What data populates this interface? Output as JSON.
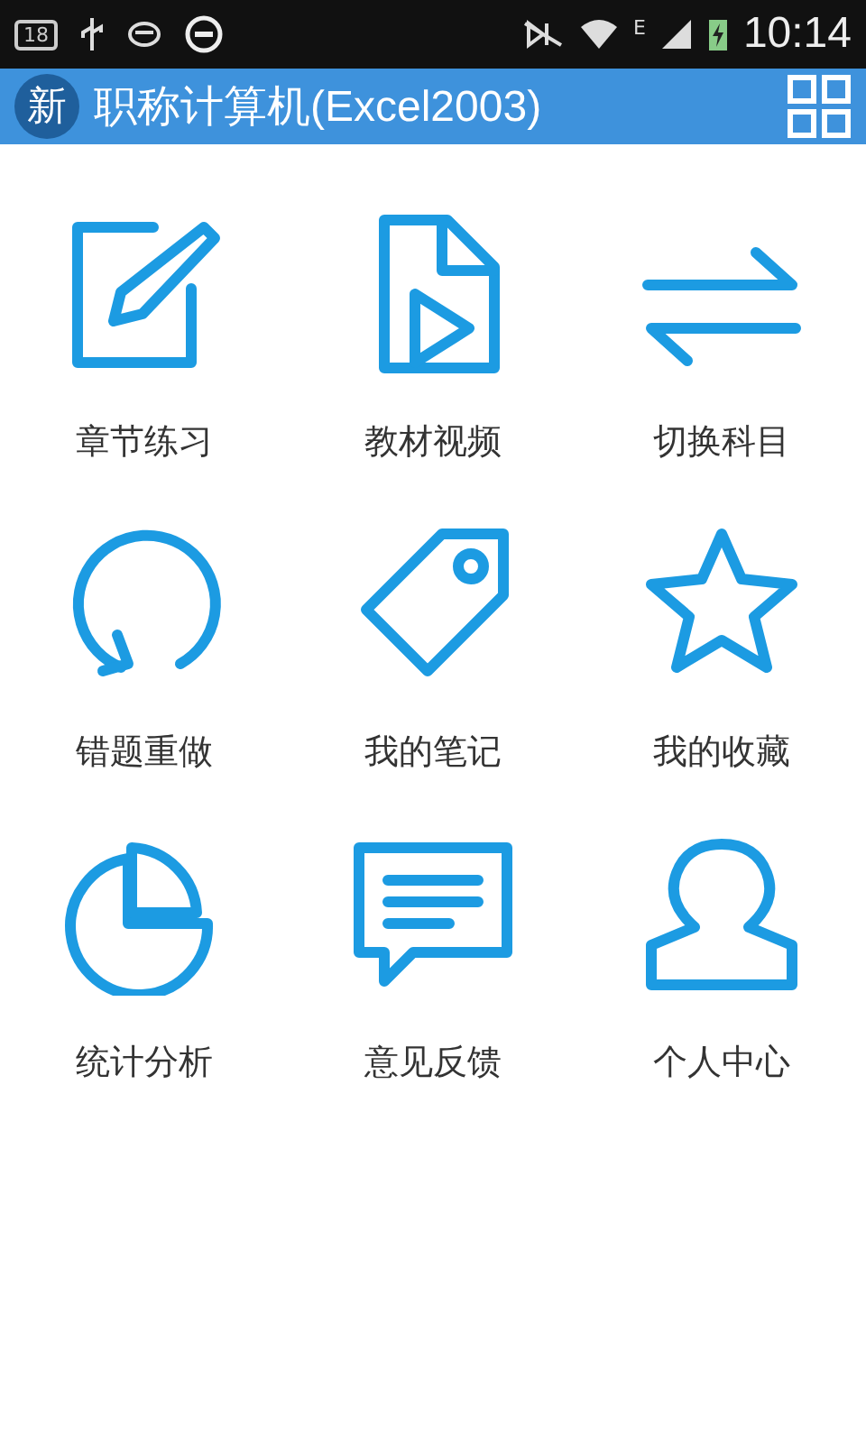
{
  "status_bar": {
    "notification_count": "18",
    "network_type": "E",
    "time": "10:14"
  },
  "header": {
    "logo_char": "新",
    "title": "职称计算机(Excel2003)"
  },
  "menu": [
    {
      "label": "章节练习"
    },
    {
      "label": "教材视频"
    },
    {
      "label": "切换科目"
    },
    {
      "label": "错题重做"
    },
    {
      "label": "我的笔记"
    },
    {
      "label": "我的收藏"
    },
    {
      "label": "统计分析"
    },
    {
      "label": "意见反馈"
    },
    {
      "label": "个人中心"
    }
  ]
}
